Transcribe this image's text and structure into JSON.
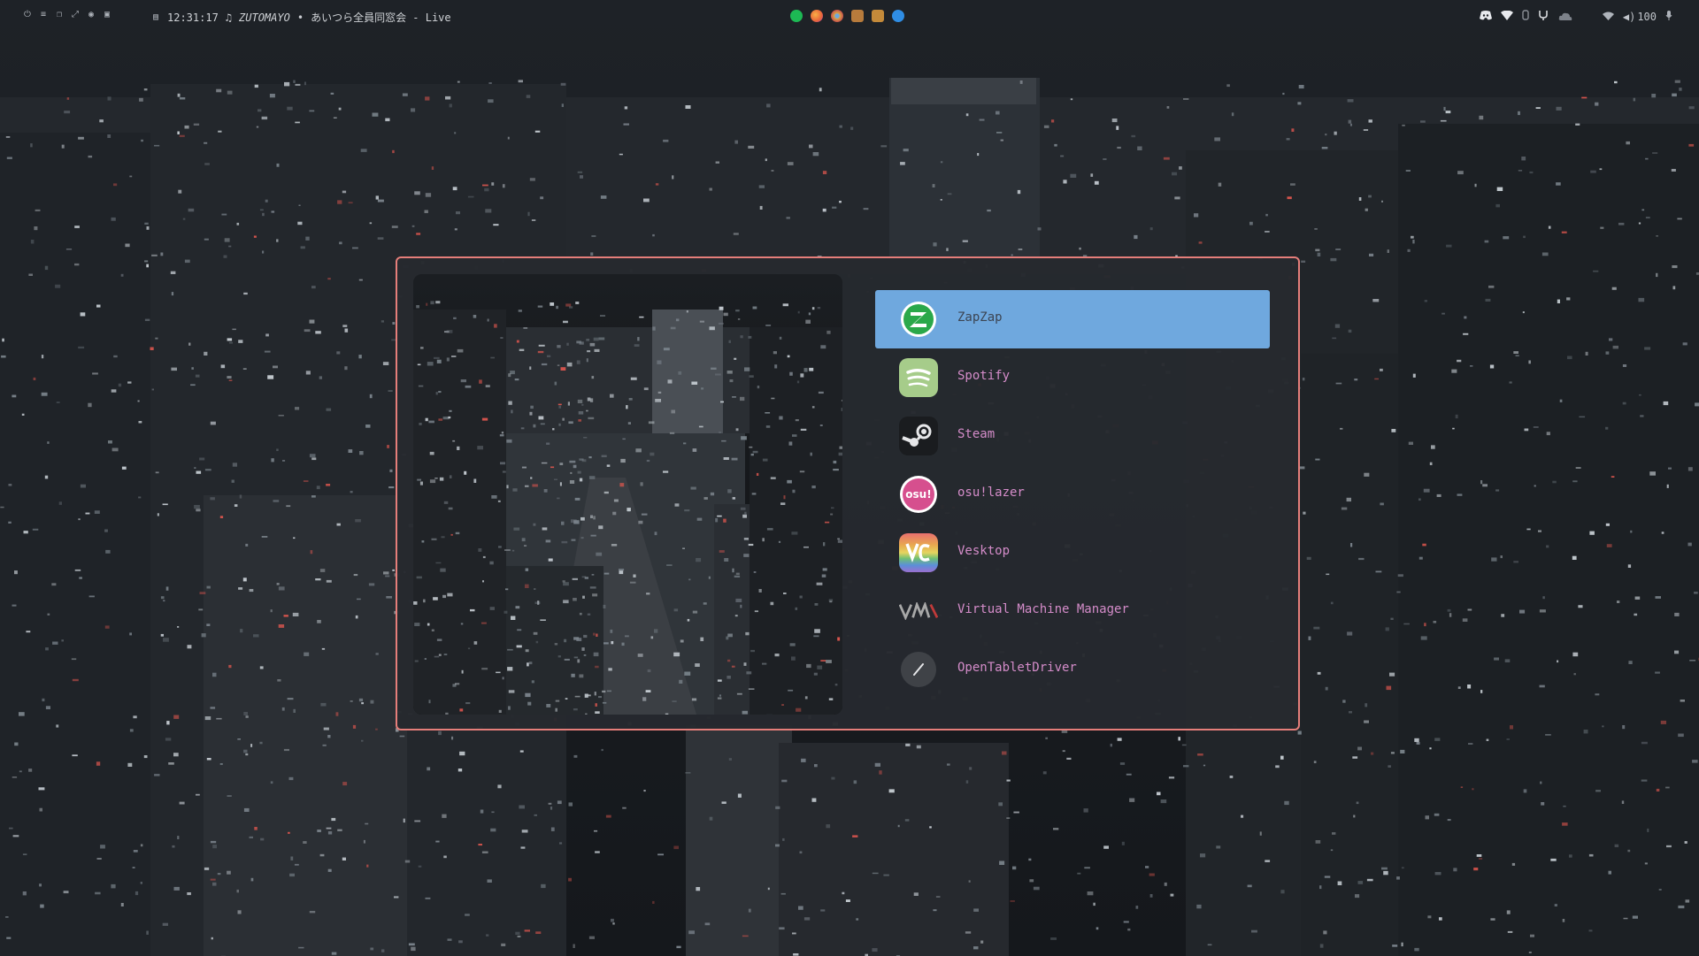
{
  "topbar": {
    "left_icons": [
      "power-icon",
      "menu-icon",
      "copy-icon",
      "fullscreen-icon",
      "palette-icon",
      "screenshot-icon"
    ],
    "clock": "12:31:17",
    "music_note": "♫",
    "artist": "ZUTOMAYO",
    "separator": "•",
    "track": "あいつら全員同窓会 - Live",
    "center_apps": [
      {
        "name": "spotify-tray-icon",
        "color": "#1db954"
      },
      {
        "name": "firefox-tray-icon",
        "color": "#e8643a"
      },
      {
        "name": "browser-tray-icon",
        "color": "#d9a54a"
      },
      {
        "name": "game-tray-icon",
        "color": "#b77b3c"
      },
      {
        "name": "lutris-tray-icon",
        "color": "#c48a3a"
      },
      {
        "name": "vscode-tray-icon",
        "color": "#2f8de4"
      }
    ],
    "right_status": {
      "volume": "100"
    }
  },
  "launcher": {
    "apps": [
      {
        "label": "ZapZap",
        "icon": "zapzap-icon",
        "selected": true
      },
      {
        "label": "Spotify",
        "icon": "spotify-icon",
        "selected": false
      },
      {
        "label": "Steam",
        "icon": "steam-icon",
        "selected": false
      },
      {
        "label": "osu!lazer",
        "icon": "osu-icon",
        "selected": false
      },
      {
        "label": "Vesktop",
        "icon": "vesktop-icon",
        "selected": false
      },
      {
        "label": "Virtual Machine Manager",
        "icon": "virt-manager-icon",
        "selected": false
      },
      {
        "label": "OpenTabletDriver",
        "icon": "opentabletdriver-icon",
        "selected": false
      }
    ],
    "osu_text": "osu!",
    "colors": {
      "border": "#e57e7a",
      "selected": "#6fa8de",
      "label": "#d48cc9"
    }
  }
}
